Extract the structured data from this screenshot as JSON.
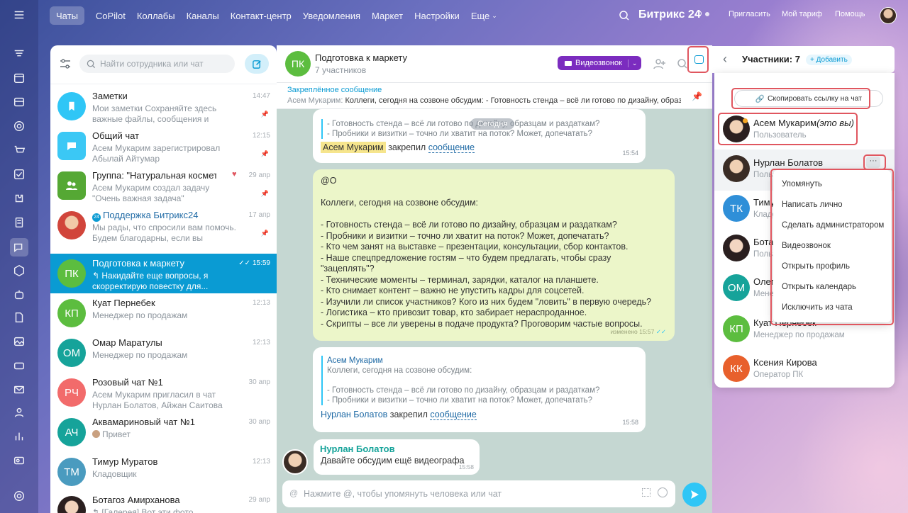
{
  "topnav": {
    "items": [
      "Чаты",
      "CoPilot",
      "Коллабы",
      "Каналы",
      "Контакт-центр",
      "Уведомления",
      "Маркет",
      "Настройки",
      "Еще"
    ],
    "brand": "Битрикс 24",
    "invite": "Пригласить",
    "tariff": "Мой тариф",
    "help": "Помощь"
  },
  "chatlist": {
    "search_placeholder": "Найти сотрудника или чат",
    "chats": [
      {
        "avatar": "",
        "name": "Заметки",
        "preview": "Мои заметки Сохраняйте здесь важные файлы, сообщения и ссылки",
        "time": "14:47"
      },
      {
        "avatar": "",
        "name": "Общий чат",
        "preview": "Асем Мукарим зарегистрировал Абылай Айтумар",
        "time": "12:15"
      },
      {
        "avatar": "",
        "name": "Группа: \"Натуральная косметика\"",
        "preview": "Асем Мукарим создал задачу \"Очень важная задача\"",
        "time": "29 апр"
      },
      {
        "avatar": "",
        "name": "Поддержка Битрикс24",
        "preview": "Мы рады, что спросили вам помочь. Будем благодарны, если вы",
        "time": "17 апр"
      },
      {
        "avatar": "ПК",
        "name": "Подготовка к маркету",
        "preview": "↰ Накидайте еще вопросы, я скорректирую повестку для...",
        "time": "15:59"
      },
      {
        "avatar": "КП",
        "name": "Куат Пернебек",
        "preview": "Менеджер по продажам",
        "time": "12:13"
      },
      {
        "avatar": "ОМ",
        "name": "Омар Маратулы",
        "preview": "Менеджер по продажам",
        "time": "12:13"
      },
      {
        "avatar": "РЧ",
        "name": "Розовый чат №1",
        "preview": "Асем Мукарим пригласил в чат Нурлан Болатов, Айжан Саитова",
        "time": "30 апр"
      },
      {
        "avatar": "АЧ",
        "name": "Аквамариновый чат №1",
        "preview": "Привет",
        "time": "30 апр"
      },
      {
        "avatar": "ТМ",
        "name": "Тимур Муратов",
        "preview": "Кладовщик",
        "time": "12:13"
      },
      {
        "avatar": "",
        "name": "Ботагоз Амирханова",
        "preview": "↰ [Галерея] Вот эти фото",
        "time": "29 апр"
      }
    ]
  },
  "chat": {
    "avatar": "ПК",
    "title": "Подготовка к маркету",
    "subtitle": "7 участников",
    "video_button": "Видеозвонок",
    "pinned_label": "Закреплённое сообщение",
    "pinned_author": "Асем Мукарим:",
    "pinned_text": "Коллеги, сегодня на созвоне обсудим: - Готовность стенда – всё ли готово по дизайну, образцам и раздаткам...",
    "date_badge": "Сегодня",
    "msg1_quote": [
      "- Готовность стенда – всё ли готово по дизайну, образцам и раздаткам?",
      "- Пробники и визитки – точно ли хватит на поток? Может, допечатать?"
    ],
    "msg1_author": "Асем Мукарим",
    "msg1_action": "закрепил",
    "msg1_link": "сообщение",
    "msg1_time": "15:54",
    "msg2_lines": [
      "@О",
      "",
      "Коллеги, сегодня на созвоне обсудим:",
      "",
      "- Готовность стенда – всё ли готово по дизайну, образцам и раздаткам?",
      "- Пробники и визитки – точно ли хватит на поток? Может, допечатать?",
      "- Кто чем занят на выставке – презентации, консультации, сбор контактов.",
      "- Наше спецпредложение гостям – что будем предлагать, чтобы сразу",
      "\"зацеплять\"?",
      "- Технические моменты – терминал, зарядки, каталог на планшете.",
      "- Кто снимает контент – важно не упустить кадры для соцсетей.",
      "- Изучили ли список участников? Кого из них будем \"ловить\" в первую очередь?",
      "- Логистика – кто привозит товар, кто забирает нераспроданное.",
      "- Скрипты – все ли уверены в подаче продукта? Проговорим частые вопросы."
    ],
    "msg2_meta": "изменено 15:57",
    "msg3_quote_author": "Асем Мукарим",
    "msg3_quote": [
      "Коллеги, сегодня на созвоне обсудим:",
      "",
      "- Готовность стенда – всё ли готово по дизайну, образцам и раздаткам?",
      "- Пробники и визитки – точно ли хватит на поток? Может, допечатать?"
    ],
    "msg3_author": "Нурлан Болатов",
    "msg3_action": "закрепил",
    "msg3_link": "сообщение",
    "msg3_time": "15:58",
    "msg4_author": "Нурлан Болатов",
    "msg4_text": "Давайте обсудим ещё видеографа",
    "msg4_time": "15:58",
    "composer_placeholder": "Нажмите @, чтобы упомянуть человека или чат"
  },
  "panel": {
    "title": "Участники: 7",
    "add": "+ Добавить",
    "copy_link": "Скопировать ссылку на чат",
    "members": [
      {
        "avatar": "",
        "name": "Асем Мукарим",
        "you": "(это вы)",
        "role": "Пользователь"
      },
      {
        "avatar": "",
        "name": "Нурлан Болатов",
        "role": "Пользователь"
      },
      {
        "avatar": "ТК",
        "name": "Тимур Кабдрахманов",
        "role": "Кладовщик"
      },
      {
        "avatar": "",
        "name": "Ботагоз Амирханова",
        "role": "Пользователь"
      },
      {
        "avatar": "ОМ",
        "name": "Олег Маратулы",
        "role": "Менеджер по продажам"
      },
      {
        "avatar": "КП",
        "name": "Куат Пернебек",
        "role": "Менеджер по продажам"
      },
      {
        "avatar": "КК",
        "name": "Ксения Кирова",
        "role": "Оператор ПК"
      }
    ],
    "menu": [
      "Упомянуть",
      "Написать лично",
      "Сделать администратором",
      "Видеозвонок",
      "Открыть профиль",
      "Открыть календарь",
      "Исключить из чата"
    ]
  },
  "colors": {
    "accent": "#2fc6f6",
    "selected": "#0a9bd3",
    "highlight": "#e0565f",
    "video_button": "#7b2cbf"
  }
}
